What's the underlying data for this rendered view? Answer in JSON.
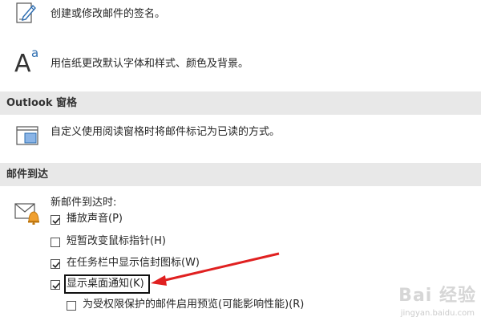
{
  "signature": {
    "description": "创建或修改邮件的签名。",
    "icon": "signature-pen-icon"
  },
  "stationery": {
    "description": "用信纸更改默认字体和样式、颜色及背景。",
    "icon": "font-aa-icon",
    "icon_glyph_big": "A",
    "icon_glyph_small": "a"
  },
  "reading_pane": {
    "header": "Outlook 窗格",
    "description": "自定义使用阅读窗格时将邮件标记为已读的方式。",
    "icon": "reading-pane-icon"
  },
  "message_arrival": {
    "header": "邮件到达",
    "intro": "新邮件到达时:",
    "icon": "mail-bell-icon",
    "options": [
      {
        "label": "播放声音(P)",
        "checked": true
      },
      {
        "label": "短暂改变鼠标指针(H)",
        "checked": false
      },
      {
        "label": "在任务栏中显示信封图标(W)",
        "checked": true
      },
      {
        "label": "显示桌面通知(K)",
        "checked": true
      },
      {
        "label": "为受权限保护的邮件启用预览(可能影响性能)(R)",
        "checked": false
      }
    ]
  },
  "colors": {
    "accent_blue": "#2b6cb0",
    "header_bg": "#e8e8e8",
    "arrow_red": "#e02020",
    "bell_orange": "#f0a030"
  },
  "watermark": {
    "text": "Bai 经验",
    "subtext": "jingyan.baidu.com"
  }
}
